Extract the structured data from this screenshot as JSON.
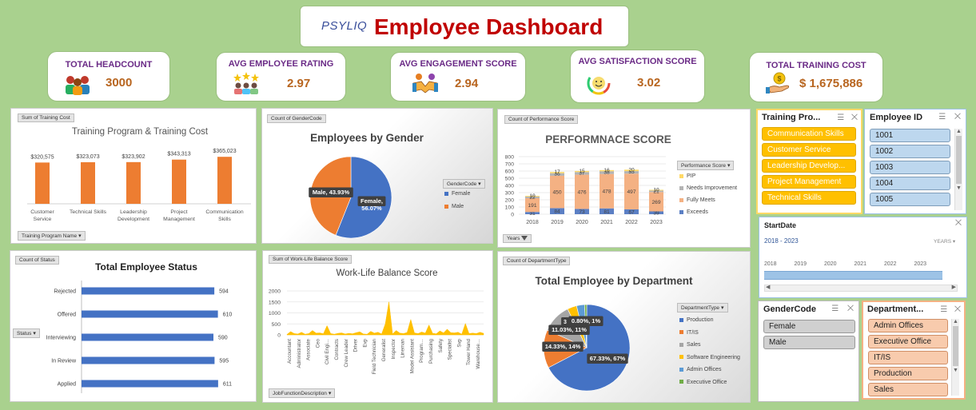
{
  "header": {
    "logo": "PSYLIQ",
    "title": "Employee Dashboard"
  },
  "kpis": [
    {
      "title": "TOTAL HEADCOUNT",
      "value": "3000",
      "icon": "team-icon"
    },
    {
      "title": "AVG EMPLOYEE RATING",
      "value": "2.97",
      "icon": "rating-stars-icon"
    },
    {
      "title": "AVG ENGAGEMENT SCORE",
      "value": "2.94",
      "icon": "handshake-icon"
    },
    {
      "title": "AVG SATISFACTION SCORE",
      "value": "3.02",
      "icon": "satisfaction-gauge-icon"
    },
    {
      "title": "TOTAL TRAINING COST",
      "value": "$ 1,675,886",
      "icon": "money-hand-icon"
    }
  ],
  "training_chart": {
    "field_chip": "Sum of Training Cost",
    "filter_chip": "Training Program Name",
    "chart_data": {
      "type": "bar",
      "title": "Training Program & Training Cost",
      "categories": [
        "Customer Service",
        "Technical Skills",
        "Leadership Development",
        "Project Management",
        "Communication Skills"
      ],
      "category_lines": [
        [
          "Customer",
          "Service"
        ],
        [
          "Technical Skills"
        ],
        [
          "Leadership",
          "Development"
        ],
        [
          "Project",
          "Management"
        ],
        [
          "Communication",
          "Skills"
        ]
      ],
      "values": [
        320575,
        323073,
        323902,
        343313,
        365023
      ],
      "labels": [
        "$320,575",
        "$323,073",
        "$323,902",
        "$343,313",
        "$365,023"
      ],
      "color": "#ed7d31"
    }
  },
  "gender_chart": {
    "field_chip": "Count of GenderCode",
    "legend_chip": "GenderCode",
    "chart_data": {
      "type": "pie",
      "title": "Employees by Gender",
      "slices": [
        {
          "name": "Female",
          "value": 56.07,
          "label": "Female, 56.07%",
          "color": "#4472c4"
        },
        {
          "name": "Male",
          "value": 43.93,
          "label": "Male, 43.93%",
          "color": "#ed7d31"
        }
      ]
    }
  },
  "performance_chart": {
    "field_chip": "Count of Performance Score",
    "filter_chip": "Years",
    "legend_chip": "Performance Score",
    "chart_data": {
      "type": "bar",
      "title": "PERFORMNACE SCORE",
      "categories": [
        "2018",
        "2019",
        "2020",
        "2021",
        "2022",
        "2023"
      ],
      "y_ticks": [
        "0",
        "100",
        "200",
        "300",
        "400",
        "500",
        "600",
        "700",
        "800"
      ],
      "ylim": [
        0,
        800
      ],
      "series": [
        {
          "name": "Exceeds",
          "color": "#5b7fc4",
          "values": [
            31,
            84,
            73,
            81,
            67,
            39
          ],
          "labels": [
            "31",
            "84",
            "73",
            "81",
            "67",
            "39"
          ]
        },
        {
          "name": "Fully Meets",
          "color": "#f4b183",
          "values": [
            191,
            450,
            476,
            478,
            497,
            269
          ],
          "labels": [
            "191",
            "450",
            "476",
            "478",
            "497",
            "269"
          ]
        },
        {
          "name": "Needs Improvement",
          "color": "#b4b4b4",
          "values": [
            22,
            36,
            37,
            38,
            35,
            21
          ],
          "labels": [
            "22",
            "36",
            "37",
            "38",
            "35",
            "21"
          ]
        },
        {
          "name": "PIP",
          "color": "#ffd966",
          "values": [
            10,
            17,
            15,
            16,
            20,
            10
          ],
          "labels": [
            "10",
            "17",
            "15",
            "16",
            "20",
            "10"
          ]
        }
      ]
    }
  },
  "status_chart": {
    "field_chip": "Count of Status",
    "filter_chip": "Status",
    "chart_data": {
      "type": "bar",
      "title": "Total Employee Status",
      "categories": [
        "Rejected",
        "Offered",
        "Interviewing",
        "In Review",
        "Applied"
      ],
      "values": [
        594,
        610,
        590,
        595,
        611
      ],
      "labels": [
        "594",
        "610",
        "590",
        "595",
        "611"
      ],
      "color": "#4472c4"
    }
  },
  "worklife_chart": {
    "field_chip": "Sum of Work-Life Balance Score",
    "filter_chip": "JobFunctionDescription",
    "chart_data": {
      "type": "area",
      "title": "Work-Life Balance Score",
      "y_ticks": [
        "0",
        "500",
        "1000",
        "1500",
        "2000"
      ],
      "ylim": [
        0,
        2000
      ],
      "x_labels": [
        "Accountant",
        "Administrator",
        "Associate",
        "Ceo",
        "Civil Engi…",
        "Contracts",
        "Crew Leader",
        "Driver",
        "Evp",
        "Field Technician",
        "Generalist",
        "Inspector",
        "Lineman",
        "Model Assistant",
        "Program…",
        "Purchasing",
        "Safety",
        "Specialist",
        "Svp",
        "Tower Hand",
        "Warehouse…"
      ],
      "values": [
        20,
        150,
        60,
        40,
        120,
        30,
        60,
        200,
        80,
        90,
        50,
        420,
        60,
        30,
        70,
        90,
        40,
        70,
        50,
        100,
        140,
        40,
        30,
        160,
        80,
        120,
        40,
        500,
        1500,
        40,
        200,
        80,
        60,
        110,
        700,
        90,
        60,
        130,
        80,
        450,
        70,
        50,
        180,
        90,
        260,
        100,
        90,
        120,
        30,
        520,
        60,
        80,
        60,
        120,
        70
      ],
      "color": "#ffc000"
    }
  },
  "department_chart": {
    "field_chip": "Count of DepartmentType",
    "legend_chip": "DepartmentType",
    "chart_data": {
      "type": "pie",
      "title": "Total Employee by Department",
      "slices": [
        {
          "name": "Production",
          "value": 67.33,
          "label": "67.33%, 67%",
          "color": "#4472c4"
        },
        {
          "name": "IT/IS",
          "value": 14.33,
          "label": "14.33%, 14%",
          "color": "#ed7d31"
        },
        {
          "name": "Sales",
          "value": 11.03,
          "label": "11.03%, 11%",
          "color": "#a5a5a5"
        },
        {
          "name": "Software Engineering",
          "value": 3.5,
          "label": "3",
          "color": "#ffc000"
        },
        {
          "name": "Admin Offices",
          "value": 3.0,
          "label": "",
          "color": "#5b9bd5"
        },
        {
          "name": "Executive Office",
          "value": 0.8,
          "label": "0.80%, 1%",
          "color": "#70ad47"
        }
      ]
    }
  },
  "slicers": {
    "training": {
      "title": "Training Pro...",
      "items": [
        "Communication Skills",
        "Customer Service",
        "Leadership Develop...",
        "Project Management",
        "Technical Skills"
      ]
    },
    "employee_id": {
      "title": "Employee ID",
      "items": [
        "1001",
        "1002",
        "1003",
        "1004",
        "1005"
      ]
    },
    "start_date": {
      "title": "StartDate",
      "range": "2018 - 2023",
      "level": "YEARS",
      "years": [
        "2018",
        "2019",
        "2020",
        "2021",
        "2022",
        "2023"
      ]
    },
    "gender": {
      "title": "GenderCode",
      "items": [
        "Female",
        "Male"
      ]
    },
    "department": {
      "title": "Department...",
      "items": [
        "Admin Offices",
        "Executive Office",
        "IT/IS",
        "Production",
        "Sales"
      ]
    }
  }
}
